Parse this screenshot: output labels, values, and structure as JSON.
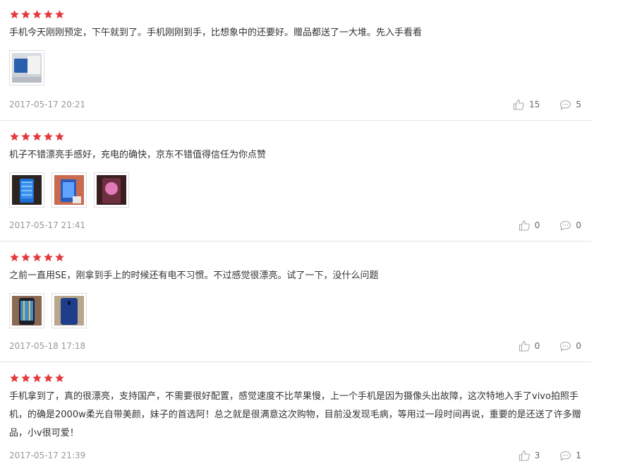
{
  "colors": {
    "star": "#e4393c",
    "date": "#999999",
    "divider": "#e3e3e3"
  },
  "reviews": [
    {
      "rating": 5,
      "text": "手机今天刚刚预定，下午就到了。手机刚刚到手，比想象中的还要好。赠品都送了一大堆。先入手看看",
      "images": [
        "photo-box-contents"
      ],
      "date": "2017-05-17 20:21",
      "likes": "15",
      "comments": "5"
    },
    {
      "rating": 5,
      "text": "机子不错漂亮手感好，充电的确快，京东不错值得信任为你点赞",
      "images": [
        "photo-phone-screen",
        "photo-phone-charging",
        "photo-phone-lit"
      ],
      "date": "2017-05-17 21:41",
      "likes": "0",
      "comments": "0"
    },
    {
      "rating": 5,
      "text": "之前一直用SE，刚拿到手上的时候还有电不习惯。不过感觉很漂亮。试了一下，没什么问题",
      "images": [
        "photo-phone-front",
        "photo-phone-back"
      ],
      "date": "2017-05-18 17:18",
      "likes": "0",
      "comments": "0"
    },
    {
      "rating": 5,
      "text": "手机拿到了，真的很漂亮，支持国产，不需要很好配置，感觉速度不比苹果慢，上一个手机是因为摄像头出故障，这次特地入手了vivo拍照手机，的确是2000w柔光自带美颜，妹子的首选阿！总之就是很满意这次购物，目前没发现毛病，等用过一段时间再说，重要的是还送了许多赠品，小v很可爱！",
      "images": [],
      "date": "2017-05-17 21:39",
      "likes": "3",
      "comments": "1"
    }
  ]
}
